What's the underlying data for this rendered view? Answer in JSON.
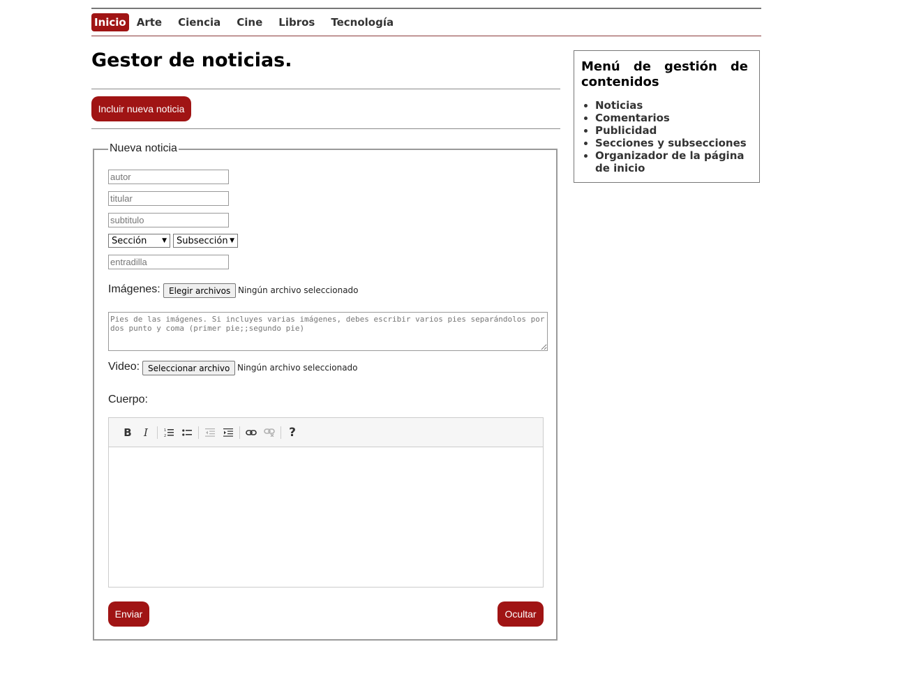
{
  "nav": {
    "items": [
      "Inicio",
      "Arte",
      "Ciencia",
      "Cine",
      "Libros",
      "Tecnología"
    ],
    "active": "Inicio"
  },
  "page_title": "Gestor de noticias.",
  "add_news_button": "Incluir nueva noticia",
  "form": {
    "legend": "Nueva noticia",
    "autor_placeholder": "autor",
    "titular_placeholder": "titular",
    "subtitulo_placeholder": "subtitulo",
    "seccion_select": "Sección",
    "subseccion_select": "Subsección",
    "entradilla_placeholder": "entradilla",
    "images_label": "Imágenes:",
    "images_button": "Elegir archivos",
    "images_status": "Ningún archivo seleccionado",
    "captions_placeholder": "Pies de las imágenes. Si incluyes varias imágenes, debes escribir varios pies separándolos por dos punto y coma (primer pie;;segundo pie)",
    "video_label": "Video:",
    "video_button": "Seleccionar archivo",
    "video_status": "Ningún archivo seleccionado",
    "body_label": "Cuerpo:",
    "toolbar": {
      "bold": "B",
      "italic": "I",
      "help": "?"
    },
    "submit_button": "Enviar",
    "hide_button": "Ocultar"
  },
  "sidebar": {
    "title_line1": "Menú de gestión de",
    "title_line2": "contenidos",
    "items": [
      "Noticias",
      "Comentarios",
      "Publicidad",
      "Secciones y subsecciones",
      "Organizador de la página de inicio"
    ]
  },
  "colors": {
    "accent": "#a01414",
    "nav_text": "#333333"
  }
}
